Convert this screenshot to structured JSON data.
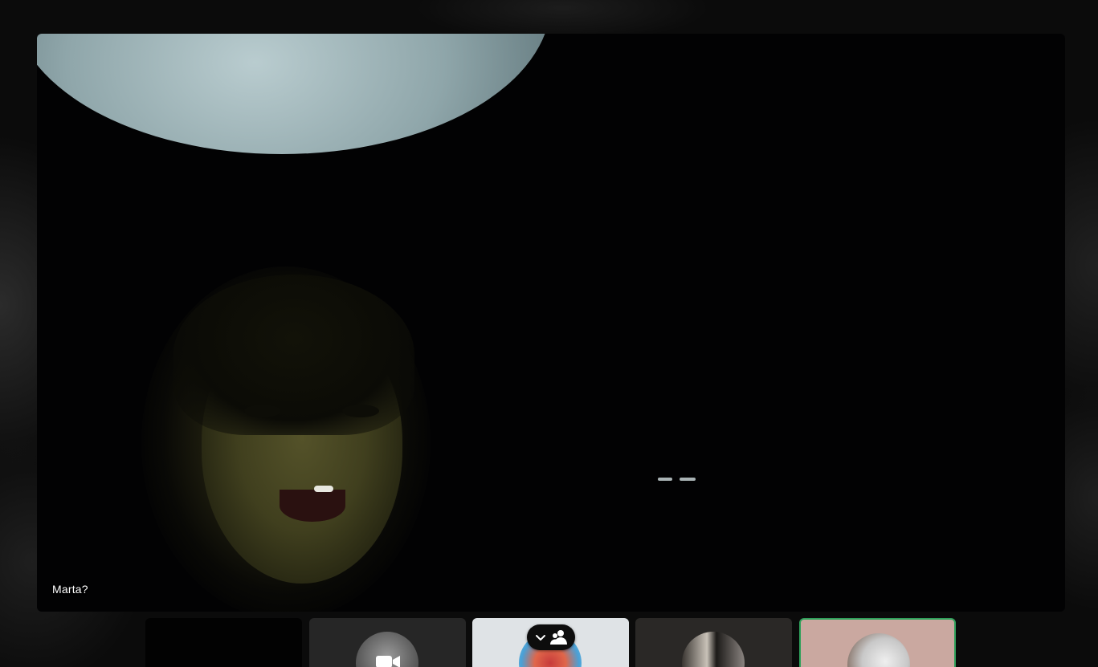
{
  "main_video": {
    "participant_name": "Marta?"
  },
  "filmstrip": {
    "tiles": [
      {
        "name": "participant-tile-empty"
      },
      {
        "name": "participant-tile-1",
        "icon": "video-camera-icon"
      },
      {
        "name": "participant-tile-2"
      },
      {
        "name": "participant-tile-3"
      },
      {
        "name": "participant-tile-4",
        "active": true,
        "highlight_color": "#2ea05a"
      }
    ],
    "toggle": {
      "icons": [
        "chevron-down-icon",
        "people-icon"
      ]
    }
  },
  "colors": {
    "background": "#0b0b0b",
    "video_background": "#020203",
    "active_speaker_border": "#2ea05a",
    "label_text": "#ffffff"
  }
}
